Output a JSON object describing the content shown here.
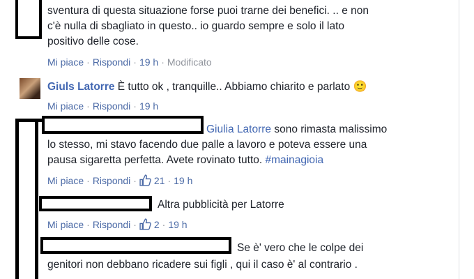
{
  "comment1": {
    "lines": [
      "sventura di questa situazione forse puoi trarne dei benefici. .. e non",
      "c'è nulla di sbagliato in questo.. io guardo sempre e solo il lato",
      "positivo delle cose."
    ],
    "actions": {
      "like": "Mi piace",
      "reply": "Rispondi",
      "time": "19 h",
      "edited": "Modificato"
    }
  },
  "comment2": {
    "author": "Giuls Latorre",
    "text": "È tutto ok , tranquille.. Abbiamo chiarito e parlato",
    "emoji": "🙂",
    "actions": {
      "like": "Mi piace",
      "reply": "Rispondi",
      "time": "19 h"
    }
  },
  "comment3": {
    "mention": "Giulia Latorre",
    "line1_rest": " sono rimasta malissimo",
    "line2": "lo stesso, mi stavo facendo due palle a lavoro e poteva essere una",
    "line3_text": "pausa sigaretta perfetta. Avete rovinato tutto. ",
    "hashtag": "#mainagioia",
    "actions": {
      "like": "Mi piace",
      "reply": "Rispondi",
      "likes": "21",
      "time": "19 h"
    }
  },
  "comment4": {
    "text": "Altra pubblicità per Latorre",
    "actions": {
      "like": "Mi piace",
      "reply": "Rispondi",
      "likes": "2",
      "time": "19 h"
    }
  },
  "comment5": {
    "line1": "Se è' vero che le colpe dei",
    "line2": "genitori non debbano ricadere sui figli , qui il caso è' al contrario ."
  },
  "colors": {
    "link": "#4267b2",
    "meta": "#90949c",
    "text": "#1d2129",
    "redaction": "#000000"
  }
}
